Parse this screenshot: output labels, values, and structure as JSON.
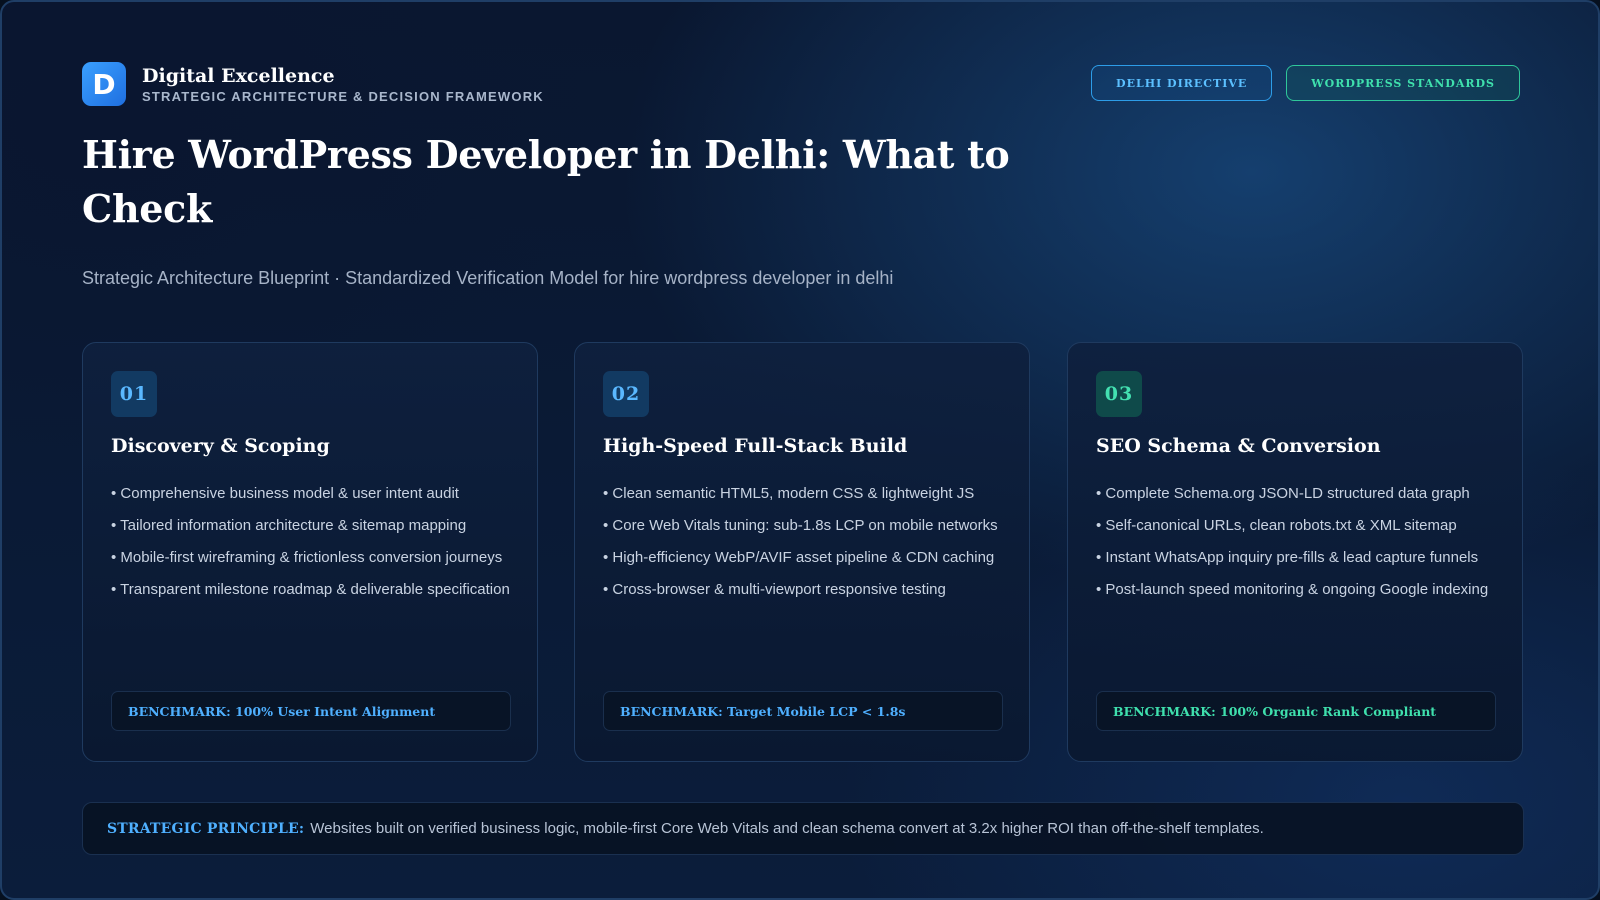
{
  "brand": {
    "logo_letter": "D",
    "name": "Digital Excellence",
    "tagline": "STRATEGIC ARCHITECTURE & DECISION FRAMEWORK"
  },
  "badges": [
    {
      "label": "DELHI DIRECTIVE",
      "color": "#5cc0ff"
    },
    {
      "label": "WORDPRESS STANDARDS",
      "color": "#3fe0ad"
    }
  ],
  "title": "Hire WordPress Developer in Delhi: What to Check",
  "subtitle": "Strategic Architecture Blueprint · Standardized Verification Model for hire wordpress developer in delhi",
  "cards": [
    {
      "number": "01",
      "title": "Discovery & Scoping",
      "bullets": [
        "Comprehensive business model & user intent audit",
        "Tailored information architecture & sitemap mapping",
        "Mobile-first wireframing & frictionless conversion journeys",
        "Transparent milestone roadmap & deliverable specification"
      ],
      "benchmark": "BENCHMARK: 100% User Intent Alignment",
      "accent": "#4fb0ff"
    },
    {
      "number": "02",
      "title": "High-Speed Full-Stack Build",
      "bullets": [
        "Clean semantic HTML5, modern CSS & lightweight JS",
        "Core Web Vitals tuning: sub-1.8s LCP on mobile networks",
        "High-efficiency WebP/AVIF asset pipeline & CDN caching",
        "Cross-browser & multi-viewport responsive testing"
      ],
      "benchmark": "BENCHMARK: Target Mobile LCP < 1.8s",
      "accent": "#4fb0ff"
    },
    {
      "number": "03",
      "title": "SEO Schema & Conversion",
      "bullets": [
        "Complete Schema.org JSON-LD structured data graph",
        "Self-canonical URLs, clean robots.txt & XML sitemap",
        "Instant WhatsApp inquiry pre-fills & lead capture funnels",
        "Post-launch speed monitoring & ongoing Google indexing"
      ],
      "benchmark": "BENCHMARK: 100% Organic Rank Compliant",
      "accent": "#3fe0ad"
    }
  ],
  "principle": {
    "label": "STRATEGIC PRINCIPLE:",
    "text": "Websites built on verified business logic, mobile-first Core Web Vitals and clean schema convert at 3.2x higher ROI than off-the-shelf templates."
  }
}
